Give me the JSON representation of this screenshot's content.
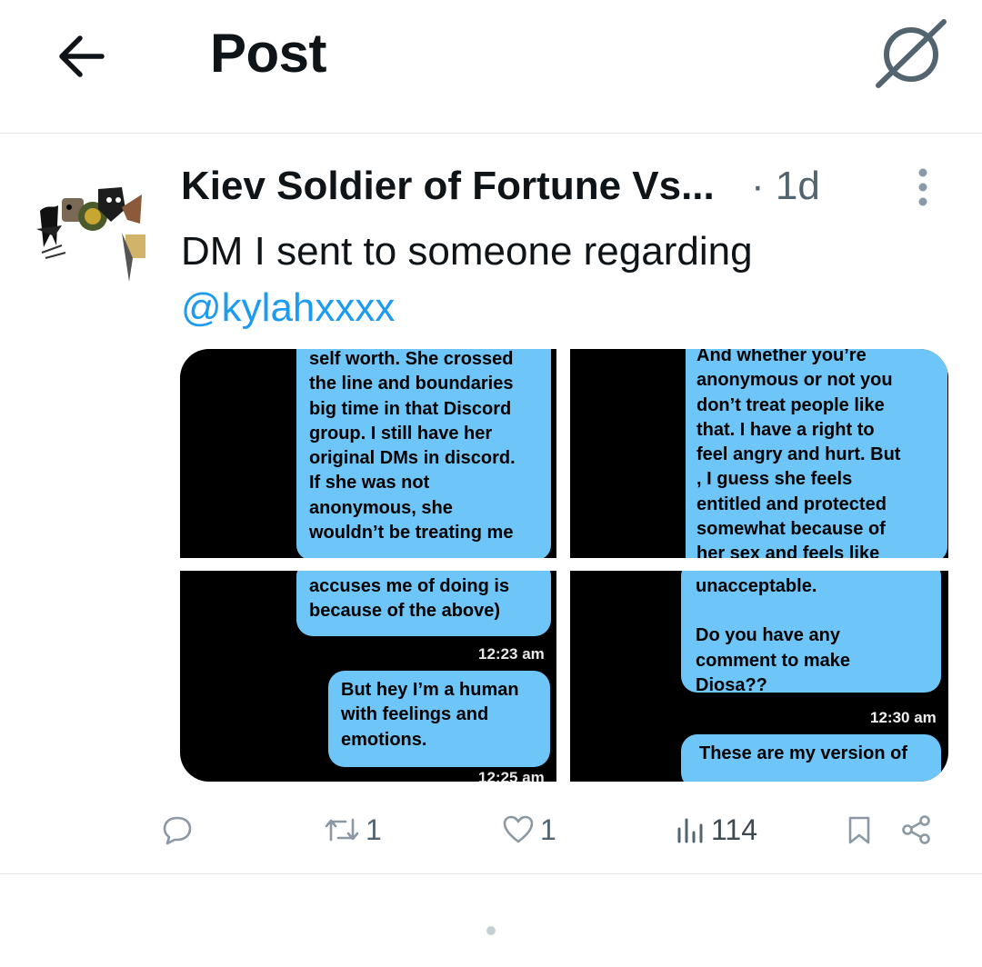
{
  "header": {
    "title": "Post",
    "back_icon": "arrow-left-icon",
    "grok_icon": "grok-icon"
  },
  "post": {
    "author_name": "Kiev Soldier of Fortune Vs...",
    "timestamp": "· 1d",
    "text": "DM I sent to someone regarding",
    "mention": "@kylahxxxx",
    "media": {
      "panel1": {
        "lines": [
          "self worth. She crossed",
          "the line and boundaries",
          "big time in that Discord",
          "group. I still have her",
          "original DMs in discord.",
          "If she was not",
          "anonymous, she",
          "wouldn’t be treating me"
        ]
      },
      "panel2": {
        "lines": [
          "And whether you’re",
          "anonymous or not you",
          "don’t treat people like",
          "that. I have a right to",
          "feel angry and hurt. But",
          ", I guess she feels",
          "entitled and protected",
          "somewhat because of",
          "her sex and feels like"
        ]
      },
      "panel3": {
        "bubble1_lines": [
          "accuses me of doing is",
          "because of the above)"
        ],
        "time1": "12:23 am",
        "bubble2_lines": [
          "But hey I’m a human",
          "with feelings and",
          "emotions."
        ],
        "time2": "12:25 am"
      },
      "panel4": {
        "bubble1_lines": [
          "unacceptable.",
          "",
          "Do you have any",
          "comment to make",
          "Diosa??"
        ],
        "time1": "12:30 am",
        "bubble2_lines": [
          "These are my version of"
        ]
      }
    },
    "actions": {
      "reposts": "1",
      "likes": "1",
      "views": "114"
    }
  }
}
